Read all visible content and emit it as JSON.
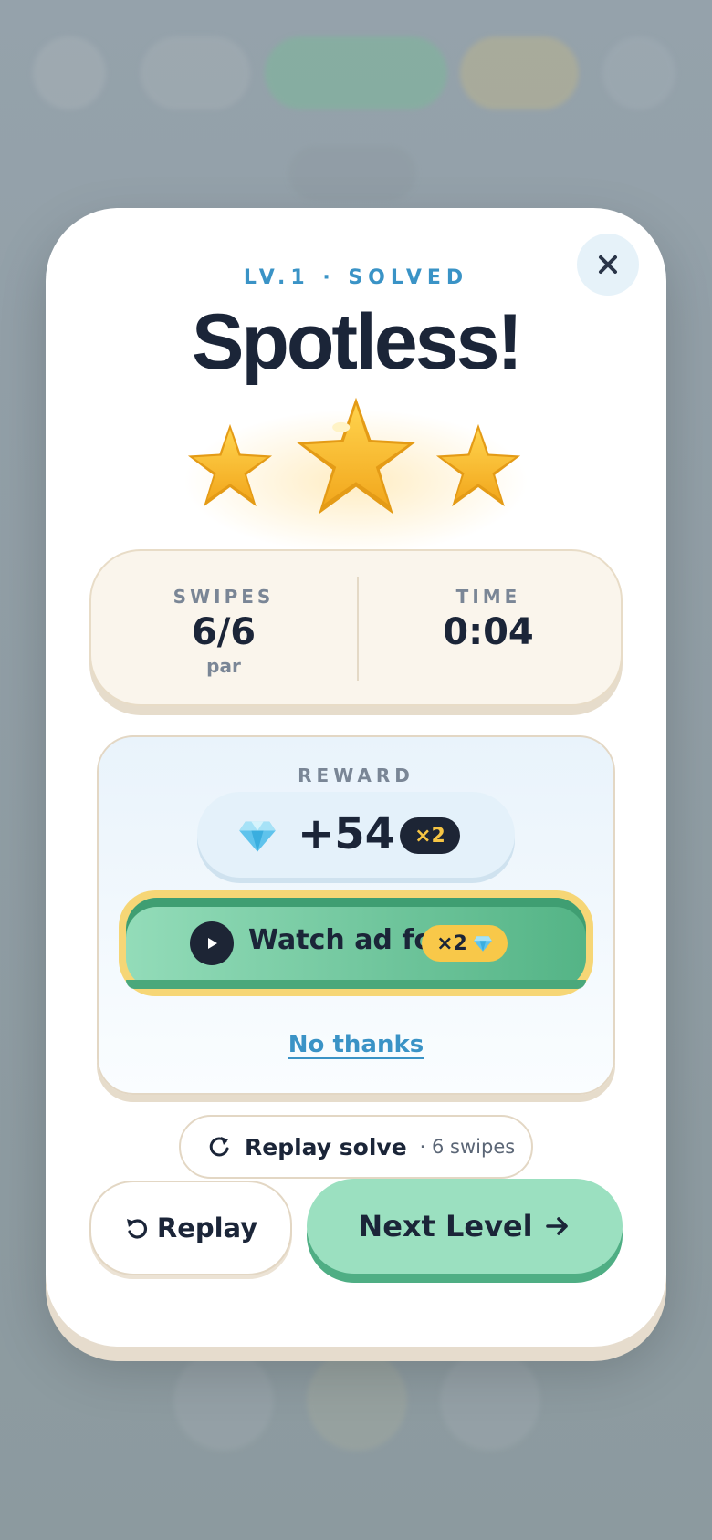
{
  "modal": {
    "eyebrow": "LV.1 · SOLVED",
    "title": "Spotless!",
    "stars_earned": 3,
    "stars_total": 3,
    "stats": {
      "swipes_label": "SWIPES",
      "swipes_value": "6/6",
      "swipes_sub": "par",
      "time_label": "TIME",
      "time_value": "0:04"
    },
    "reward": {
      "label": "REWARD",
      "amount": "+54",
      "multiplier_badge": "×2",
      "currency_icon": "diamond-icon",
      "ad_button_label": "Watch ad for",
      "ad_badge": "×2",
      "no_thanks": "No thanks"
    },
    "replay_solve": {
      "label": "Replay solve",
      "meta": "· 6 swipes"
    },
    "replay_label": "Replay",
    "next_label": "Next Level"
  },
  "colors": {
    "accent_blue": "#3a93c6",
    "gold": "#f6c544",
    "green": "#9be0c0",
    "dark": "#1b2538"
  }
}
